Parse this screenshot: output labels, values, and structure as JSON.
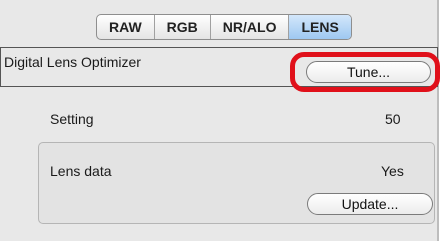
{
  "tabs": [
    "RAW",
    "RGB",
    "NR/ALO",
    "LENS"
  ],
  "active_tab": "LENS",
  "dlo": {
    "label": "Digital Lens Optimizer",
    "tune_button": "Tune..."
  },
  "setting": {
    "label": "Setting",
    "value": "50"
  },
  "lens_data": {
    "label": "Lens data",
    "value": "Yes",
    "update_button": "Update..."
  },
  "colors": {
    "highlight": "#e0101a",
    "active_tab": "#9ec8f1"
  }
}
